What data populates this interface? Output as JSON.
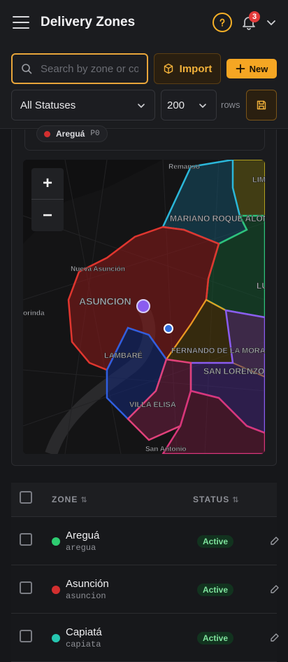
{
  "header": {
    "title": "Delivery Zones",
    "notification_count": "3"
  },
  "toolbar": {
    "search_placeholder": "Search by zone or code",
    "import_label": "Import",
    "new_label": "New",
    "status_filter": "All Statuses",
    "rows_value": "200",
    "rows_label": "rows"
  },
  "legend": {
    "name": "Areguá",
    "code": "P0"
  },
  "map": {
    "labels": [
      "Remanso",
      "LIM",
      "MARIANO ROQUE ALONSO",
      "LUQUE",
      "Nueva Asunción",
      "ASUNCION",
      "orinda",
      "FERNANDO DE LA MORA",
      "SAN LORENZO",
      "LAMBARÉ",
      "VILLA ELISA",
      "San Antonio"
    ],
    "zoom_in": "+",
    "zoom_out": "−"
  },
  "table": {
    "columns": [
      "ZONE",
      "STATUS"
    ],
    "rows": [
      {
        "name": "Areguá",
        "code": "aregua",
        "status": "Active",
        "color": "#2ecc71"
      },
      {
        "name": "Asunción",
        "code": "asuncion",
        "status": "Active",
        "color": "#d32f2f"
      },
      {
        "name": "Capiatá",
        "code": "capiata",
        "status": "Active",
        "color": "#26c6b0"
      }
    ]
  },
  "colors": {
    "accent": "#f5a623",
    "active_text": "#7ee29c"
  }
}
